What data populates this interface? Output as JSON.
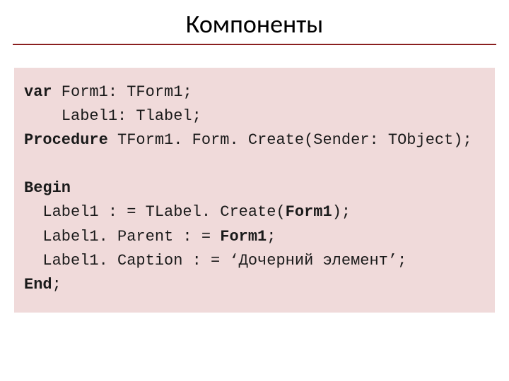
{
  "title": "Компоненты",
  "code": {
    "l1_kw": "var",
    "l1_rest": " Form1: TForm1;",
    "l2": "    Label1: Tlabel;",
    "l3_kw": "Procedure",
    "l3_rest": " TForm1. Form. Create(Sender: TObject);",
    "blank1": "",
    "l4_kw": "Begin",
    "l5a": "  Label1 : = TLabel. Create(",
    "l5b_kw": "Form1",
    "l5c": ");",
    "l6a": "  Label1. Parent : = ",
    "l6b_kw": "Form1",
    "l6c": ";",
    "l7": "  Label1. Caption : = ‘Дочерний элемент’;",
    "l8_kw": "End",
    "l8_rest": ";"
  }
}
